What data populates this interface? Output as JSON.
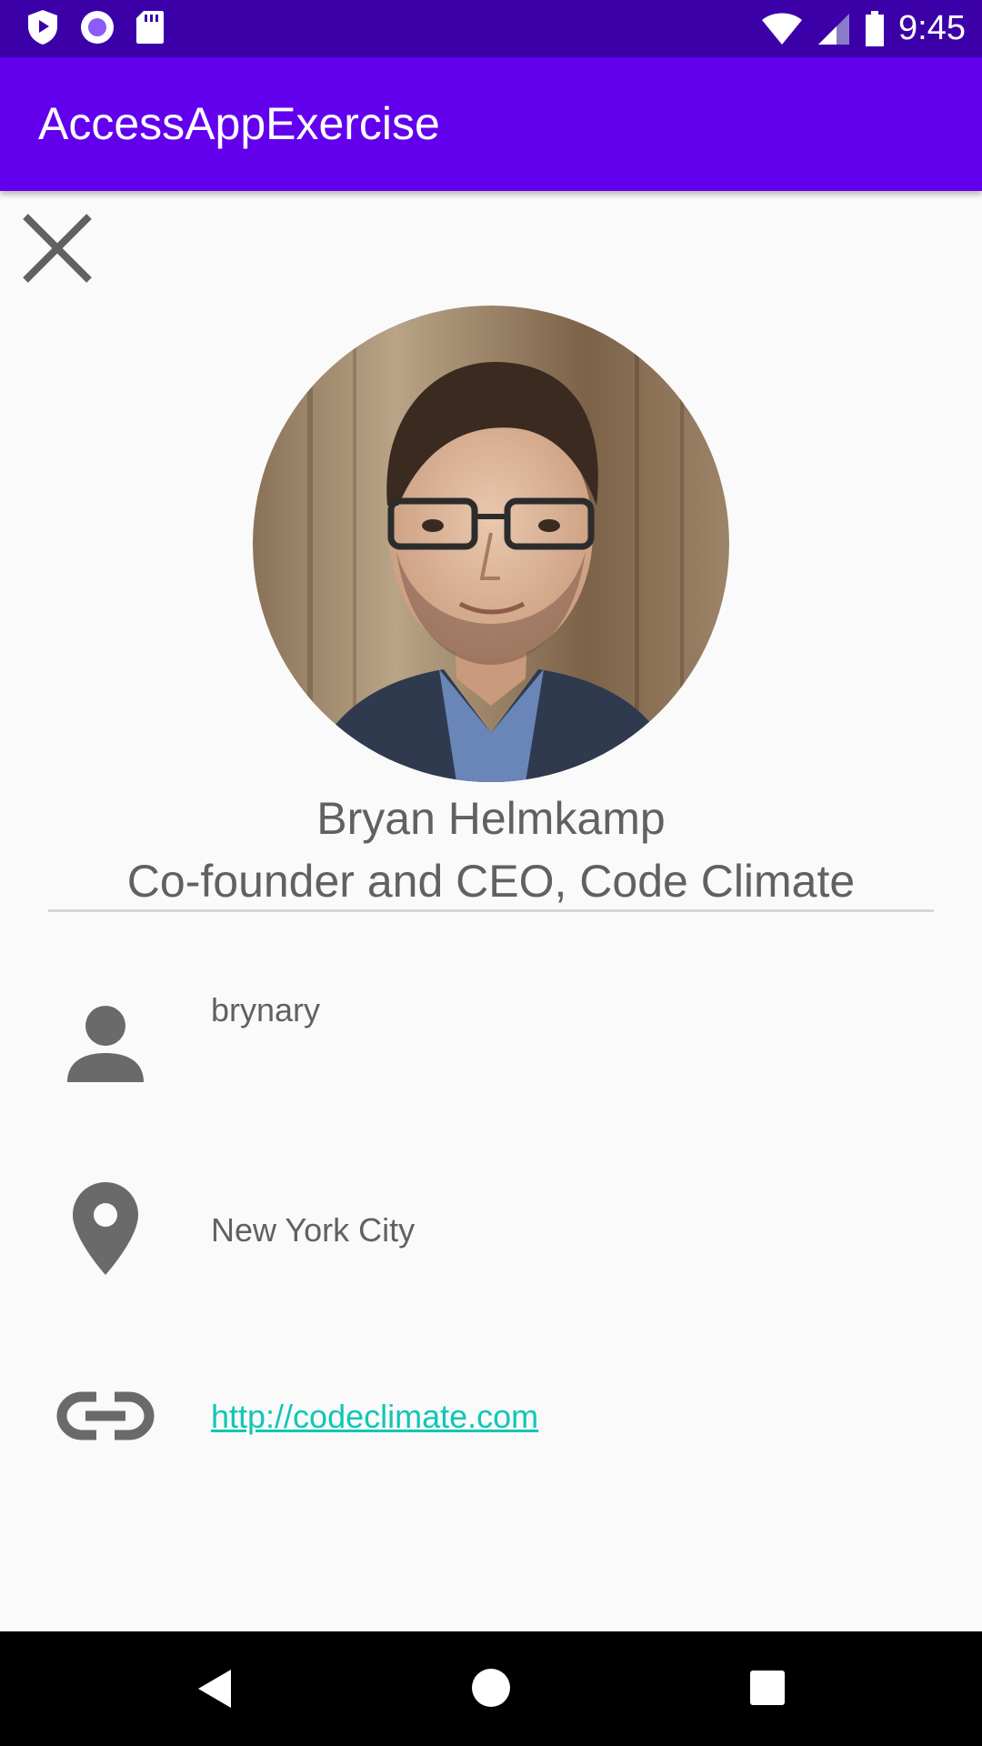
{
  "status_bar": {
    "time": "9:45",
    "icons": [
      "play-protect-icon",
      "record-icon",
      "sd-card-icon",
      "wifi-icon",
      "cell-signal-icon",
      "battery-icon"
    ]
  },
  "app_bar": {
    "title": "AccessAppExercise",
    "background_color": "#6200ee"
  },
  "profile": {
    "name": "Bryan Helmkamp",
    "title": "Co-founder and CEO, Code Climate",
    "username": "brynary",
    "location": "New York City",
    "website": "http://codeclimate.com"
  },
  "icons": {
    "close": "close-icon",
    "person": "person-icon",
    "location": "location-pin-icon",
    "link": "link-icon"
  },
  "colors": {
    "status_bar": "#3c00a9",
    "accent_link": "#12c6b5",
    "text_gray": "#616161"
  },
  "nav_bar": {
    "buttons": [
      "back-icon",
      "home-icon",
      "recents-icon"
    ]
  }
}
